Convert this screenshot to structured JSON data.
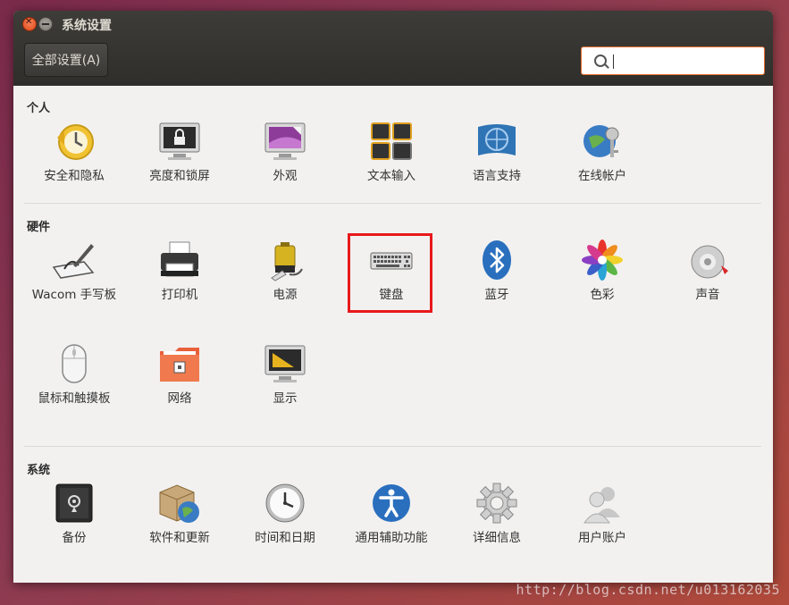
{
  "window": {
    "title": "系统设置",
    "all_settings_label": "全部设置(A)"
  },
  "search": {
    "value": "",
    "placeholder": ""
  },
  "sections": [
    {
      "title": "个人",
      "items": [
        {
          "label": "安全和隐私",
          "icon": "security-clock-icon"
        },
        {
          "label": "亮度和锁屏",
          "icon": "brightness-lock-icon"
        },
        {
          "label": "外观",
          "icon": "appearance-icon"
        },
        {
          "label": "文本输入",
          "icon": "text-entry-icon"
        },
        {
          "label": "语言支持",
          "icon": "language-icon"
        },
        {
          "label": "在线帐户",
          "icon": "online-accounts-icon"
        }
      ]
    },
    {
      "title": "硬件",
      "items": [
        {
          "label": "Wacom 手写板",
          "icon": "wacom-tablet-icon"
        },
        {
          "label": "打印机",
          "icon": "printer-icon"
        },
        {
          "label": "电源",
          "icon": "power-battery-icon"
        },
        {
          "label": "键盘",
          "icon": "keyboard-icon"
        },
        {
          "label": "蓝牙",
          "icon": "bluetooth-icon"
        },
        {
          "label": "色彩",
          "icon": "color-icon"
        },
        {
          "label": "声音",
          "icon": "sound-icon"
        },
        {
          "label": "鼠标和触摸板",
          "icon": "mouse-icon"
        },
        {
          "label": "网络",
          "icon": "network-icon"
        },
        {
          "label": "显示",
          "icon": "display-icon"
        }
      ]
    },
    {
      "title": "系统",
      "items": [
        {
          "label": "备份",
          "icon": "backup-safe-icon"
        },
        {
          "label": "软件和更新",
          "icon": "software-updates-icon"
        },
        {
          "label": "时间和日期",
          "icon": "clock-icon"
        },
        {
          "label": "通用辅助功能",
          "icon": "accessibility-icon"
        },
        {
          "label": "详细信息",
          "icon": "gear-icon"
        },
        {
          "label": "用户账户",
          "icon": "user-accounts-icon"
        }
      ]
    }
  ],
  "watermark": "http://blog.csdn.net/u013162035",
  "colors": {
    "accent": "#e96c2d",
    "highlight_border": "#e8191b",
    "titlebar": "#3d3c38"
  }
}
